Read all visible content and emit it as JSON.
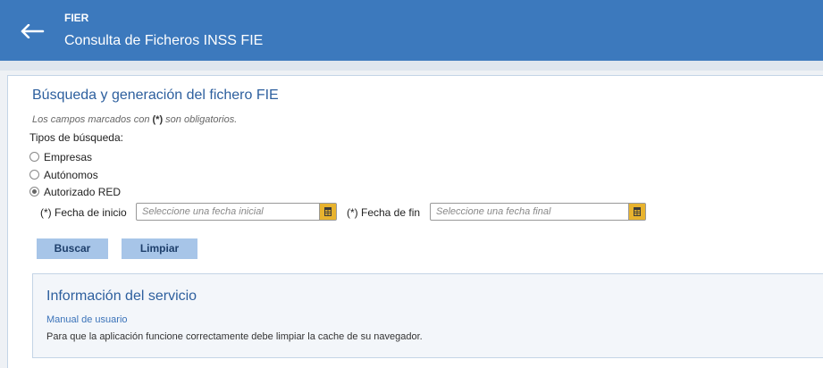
{
  "header": {
    "back_icon": "arrow-left-icon",
    "app_name": "FIER",
    "subtitle": "Consulta de Ficheros INSS FIE"
  },
  "form": {
    "title": "Búsqueda y generación del fichero FIE",
    "required_note_pre": "Los campos marcados con ",
    "required_note_mark": "(*)",
    "required_note_post": " son obligatorios.",
    "search_types_label": "Tipos de búsqueda:",
    "search_types": [
      {
        "label": "Empresas",
        "selected": false
      },
      {
        "label": "Autónomos",
        "selected": false
      },
      {
        "label": "Autorizado RED",
        "selected": true
      }
    ],
    "start_date": {
      "label": "(*) Fecha de inicio",
      "placeholder": "Seleccione una fecha inicial",
      "value": "",
      "icon": "calendar-icon"
    },
    "end_date": {
      "label": "(*) Fecha de fin",
      "placeholder": "Seleccione una fecha final",
      "value": "",
      "icon": "calendar-icon"
    },
    "buttons": {
      "search": "Buscar",
      "clear": "Limpiar"
    }
  },
  "info": {
    "title": "Información del servicio",
    "manual_link": "Manual de usuario",
    "cache_note": "Para que la aplicación funcione correctamente debe limpiar la cache de su navegador."
  },
  "colors": {
    "header_bg": "#3c79bd",
    "accent_text": "#2d5f9e",
    "button_bg": "#a7c5e8",
    "calendar_icon": "#e8b32e"
  }
}
